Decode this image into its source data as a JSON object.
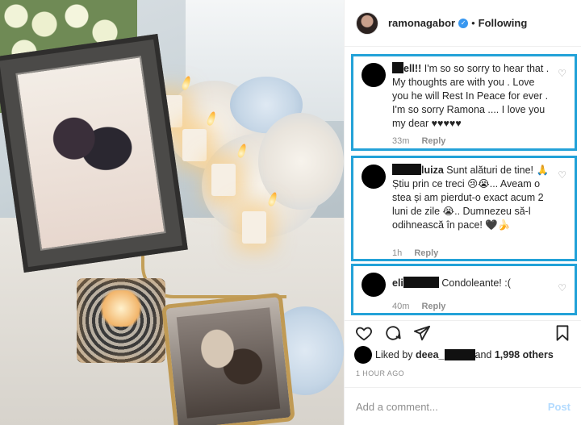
{
  "post": {
    "author": "ramonagabor",
    "separator": "•",
    "follow_state": "Following",
    "verified_mark": "✓"
  },
  "comments": [
    {
      "user_visible": "el",
      "text": "I'm so so sorry to hear that . My thoughts are with you . Love you he will Rest In Peace for ever . I'm so sorry Ramona .... I love you my dear ♥♥♥♥♥",
      "time": "33m",
      "reply": "Reply"
    },
    {
      "user_visible": "luiza",
      "text": "Sunt alături de tine! 🙏Știu prin ce treci 😢😭... Aveam o stea și am pierdut-o exact acum 2 luni de zile 😭.. Dumnezeu să-l odihnească în pace! 🖤🍌",
      "time": "1h",
      "reply": "Reply"
    },
    {
      "user_visible": "eli",
      "text": "Condoleante! :(",
      "time": "40m",
      "reply": "Reply"
    }
  ],
  "likes": {
    "prefix": "Liked by",
    "user_visible": "deea_",
    "suffix": "and",
    "others": "1,998 others"
  },
  "timestamp": "1 HOUR AGO",
  "add_comment": {
    "placeholder": "Add a comment...",
    "post_label": "Post"
  },
  "icons": {
    "like": "heart-icon",
    "comment": "comment-icon",
    "share": "share-icon",
    "save": "bookmark-icon"
  },
  "colors": {
    "highlight_border": "#23a2d8",
    "verified": "#3897f0",
    "post_disabled": "#b3dbff",
    "secondary_text": "#8e8e8e"
  }
}
